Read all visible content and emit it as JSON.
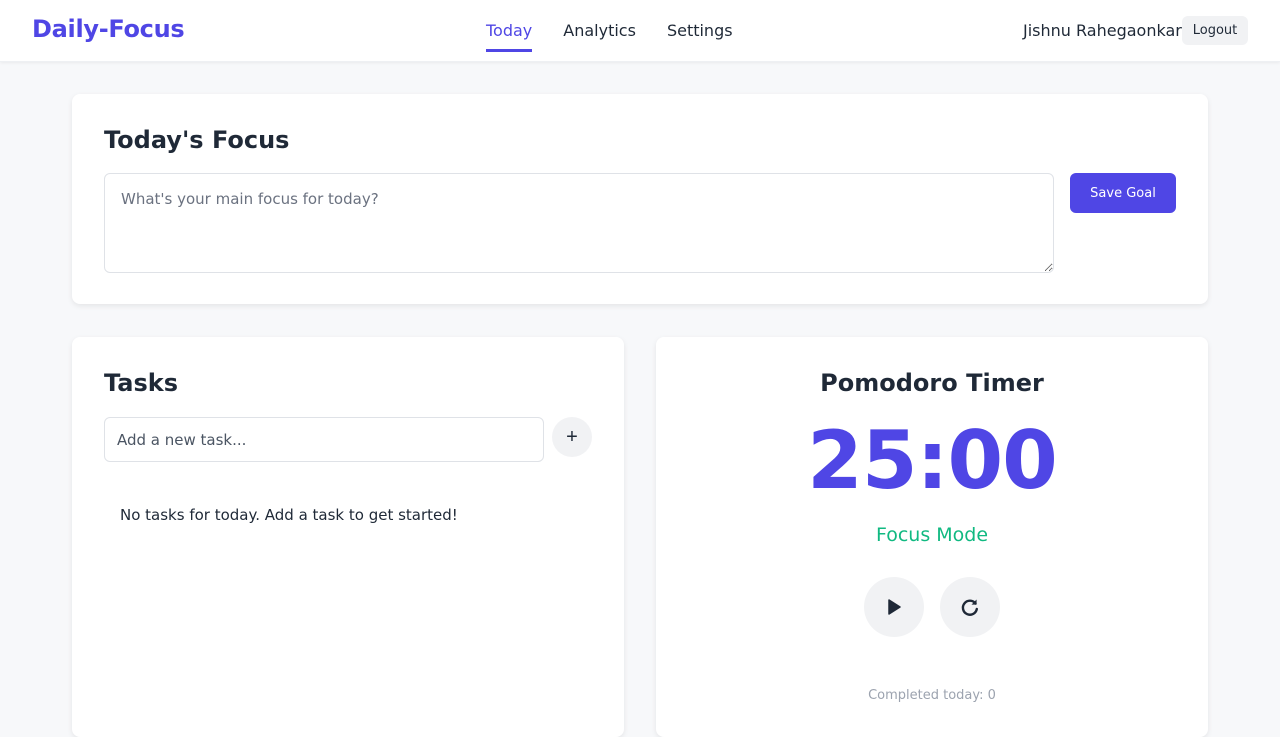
{
  "app": {
    "brand": "Daily-Focus"
  },
  "nav": {
    "links": [
      {
        "label": "Today",
        "active": true
      },
      {
        "label": "Analytics",
        "active": false
      },
      {
        "label": "Settings",
        "active": false
      }
    ],
    "user_name": "Jishnu Rahegaonkar",
    "logout_label": "Logout"
  },
  "focus": {
    "title": "Today's Focus",
    "placeholder": "What's your main focus for today?",
    "value": "",
    "save_label": "Save Goal"
  },
  "tasks": {
    "title": "Tasks",
    "input_placeholder": "Add a new task...",
    "add_icon": "+",
    "empty_message": "No tasks for today. Add a task to get started!"
  },
  "timer": {
    "title": "Pomodoro Timer",
    "display": "25:00",
    "mode": "Focus Mode",
    "play_icon": "play-icon",
    "reset_icon": "reset-icon",
    "completed_label": "Completed today: 0"
  },
  "colors": {
    "accent": "#4f46e5",
    "focus_mode": "#10b981",
    "background": "#f7f8fa"
  }
}
